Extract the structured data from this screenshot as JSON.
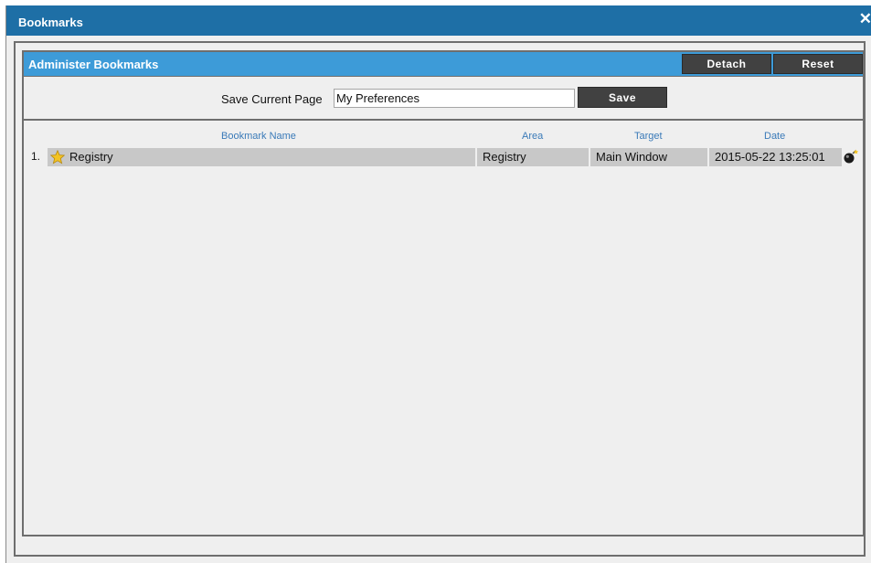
{
  "dialog": {
    "title": "Bookmarks",
    "close_glyph": "✕"
  },
  "panel": {
    "title": "Administer Bookmarks",
    "detach_label": "Detach",
    "reset_label": "Reset"
  },
  "save_row": {
    "label": "Save Current Page",
    "input_value": "My Preferences",
    "save_label": "Save"
  },
  "table": {
    "columns": [
      "Bookmark Name",
      "Area",
      "Target",
      "Date"
    ],
    "rows": [
      {
        "index": "1.",
        "name": "Registry",
        "area": "Registry",
        "target": "Main Window",
        "date": "2015-05-22 13:25:01",
        "name_icon": "star-icon",
        "action_icon": "launch-bookmark-icon"
      }
    ]
  },
  "colors": {
    "titlebar": "#1e6fa6",
    "panel_header": "#3d9bd8",
    "button": "#414141",
    "column_header_text": "#3a7ab8",
    "row_cell": "#c8c8c8",
    "background": "#efefef"
  }
}
